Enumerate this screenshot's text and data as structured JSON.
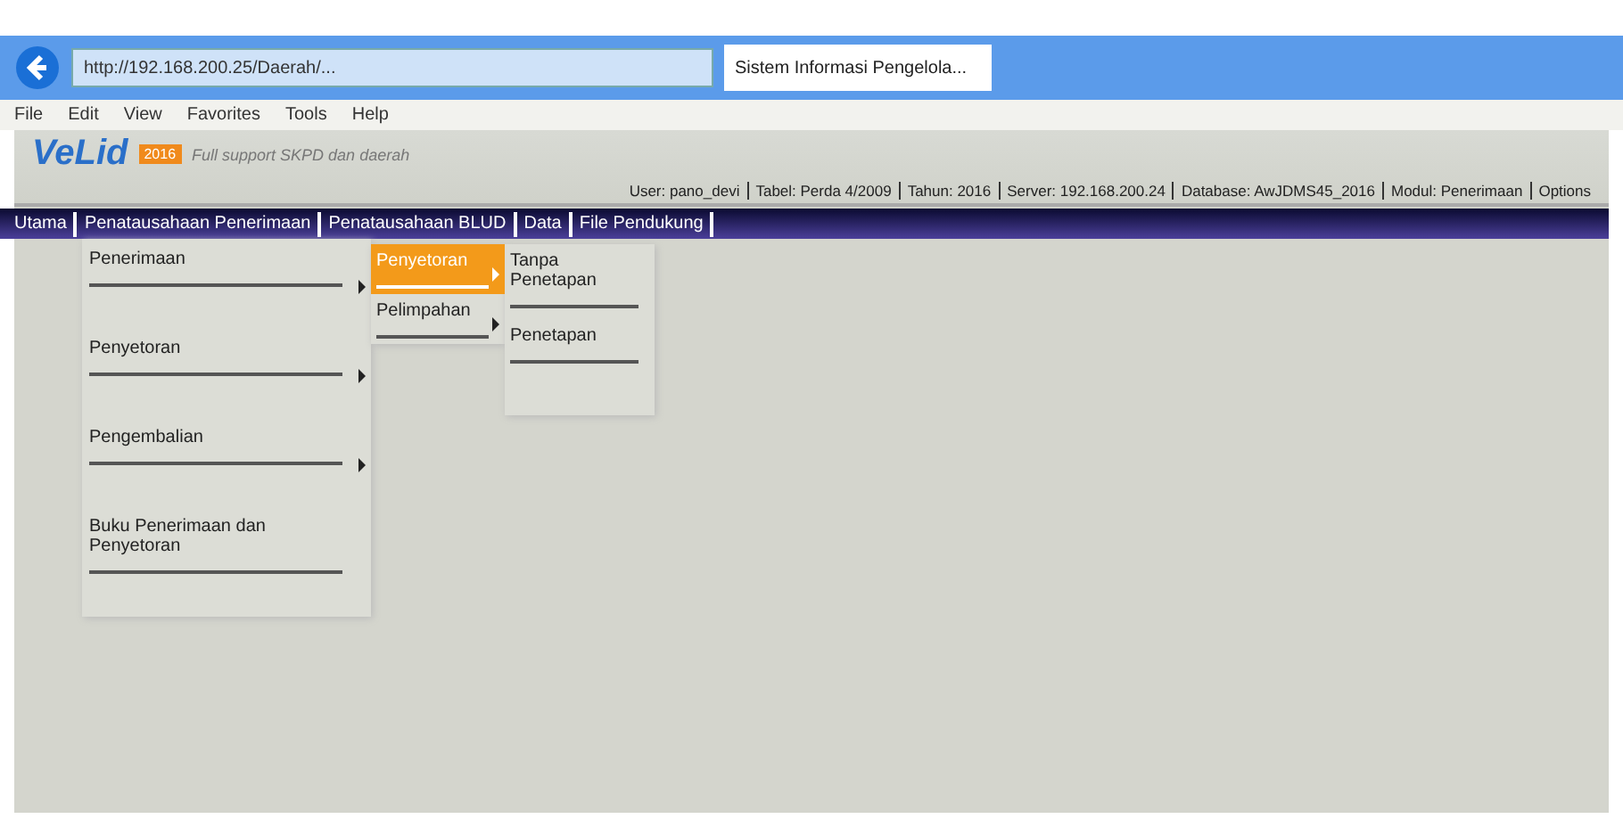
{
  "browser": {
    "url": "http://192.168.200.25/Daerah/...",
    "tab_title": "Sistem Informasi Pengelola...",
    "menu": [
      "File",
      "Edit",
      "View",
      "Favorites",
      "Tools",
      "Help"
    ]
  },
  "app": {
    "logo": "VeLid",
    "logo_badge": "2016",
    "tagline": "Full support SKPD dan daerah",
    "info": [
      "User: pano_devi",
      "Tabel: Perda 4/2009",
      "Tahun: 2016",
      "Server: 192.168.200.24",
      "Database: AwJDMS45_2016",
      "Modul: Penerimaan",
      "Options"
    ]
  },
  "nav": [
    "Utama",
    "Penatausahaan Penerimaan",
    "Penatausahaan BLUD",
    "Data",
    "File Pendukung"
  ],
  "menus": [
    {
      "items": [
        {
          "label": "Penerimaan",
          "submenu": true,
          "selected": false
        },
        {
          "label": "Penyetoran",
          "submenu": true,
          "selected": false
        },
        {
          "label": "Pengembalian",
          "submenu": true,
          "selected": false
        },
        {
          "label": "Buku Penerimaan dan Penyetoran",
          "submenu": false,
          "selected": false
        }
      ]
    },
    {
      "items": [
        {
          "label": "Penyetoran",
          "submenu": true,
          "selected": true
        },
        {
          "label": "Pelimpahan",
          "submenu": true,
          "selected": false
        }
      ]
    },
    {
      "items": [
        {
          "label": "Tanpa Penetapan",
          "submenu": false,
          "selected": false
        },
        {
          "label": "Penetapan",
          "submenu": false,
          "selected": false
        }
      ]
    }
  ]
}
